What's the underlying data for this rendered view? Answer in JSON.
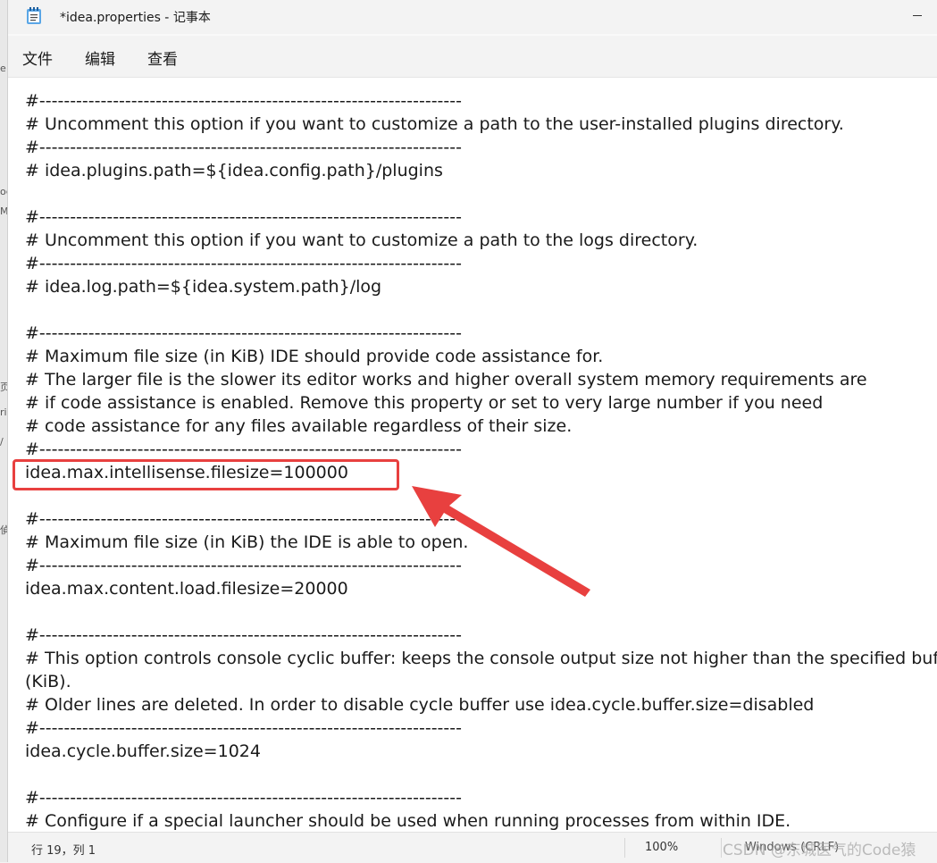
{
  "background_window": {
    "fragments": [
      "e",
      "oe",
      "ME",
      "页",
      "ri",
      "/",
      "偵"
    ]
  },
  "window": {
    "title": "*idea.properties - 记事本",
    "icon": "notepad-icon"
  },
  "menu": {
    "items": [
      "文件",
      "编辑",
      "查看"
    ]
  },
  "editor": {
    "lines": [
      "#---------------------------------------------------------------------",
      "# Uncomment this option if you want to customize a path to the user-installed plugins directory.",
      "#---------------------------------------------------------------------",
      "# idea.plugins.path=${idea.config.path}/plugins",
      "",
      "#---------------------------------------------------------------------",
      "# Uncomment this option if you want to customize a path to the logs directory.",
      "#---------------------------------------------------------------------",
      "# idea.log.path=${idea.system.path}/log",
      "",
      "#---------------------------------------------------------------------",
      "# Maximum file size (in KiB) IDE should provide code assistance for.",
      "# The larger file is the slower its editor works and higher overall system memory requirements are",
      "# if code assistance is enabled. Remove this property or set to very large number if you need",
      "# code assistance for any files available regardless of their size.",
      "#---------------------------------------------------------------------",
      "idea.max.intellisense.filesize=100000",
      "",
      "#---------------------------------------------------------------------",
      "# Maximum file size (in KiB) the IDE is able to open.",
      "#---------------------------------------------------------------------",
      "idea.max.content.load.filesize=20000",
      "",
      "#---------------------------------------------------------------------",
      "# This option controls console cyclic buffer: keeps the console output size not higher than the specified buffer size",
      "(KiB).",
      "# Older lines are deleted. In order to disable cycle buffer use idea.cycle.buffer.size=disabled",
      "#---------------------------------------------------------------------",
      "idea.cycle.buffer.size=1024",
      "",
      "#---------------------------------------------------------------------",
      "# Configure if a special launcher should be used when running processes from within IDE."
    ],
    "highlighted_line_index": 16,
    "annotation_color": "#e8403f"
  },
  "status": {
    "position": "行 19，列 1",
    "zoom": "100%",
    "eol": "Windows (CRLF)",
    "watermark": "CSDN @东城医气的Code猿"
  }
}
